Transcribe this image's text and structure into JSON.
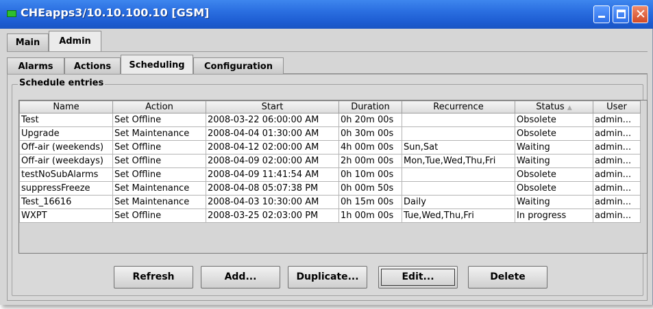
{
  "window": {
    "title": "CHEapps3/10.10.100.10 [GSM]"
  },
  "main_tabs": [
    {
      "label": "Main",
      "active": false
    },
    {
      "label": "Admin",
      "active": true
    }
  ],
  "sub_tabs": [
    {
      "label": "Alarms",
      "active": false
    },
    {
      "label": "Actions",
      "active": false
    },
    {
      "label": "Scheduling",
      "active": true
    },
    {
      "label": "Configuration",
      "active": false
    }
  ],
  "group_title": "Schedule entries",
  "table": {
    "columns": [
      "Name",
      "Action",
      "Start",
      "Duration",
      "Recurrence",
      "Status",
      "User"
    ],
    "rows": [
      [
        "Test",
        "Set Offline",
        "2008-03-22 06:00:00 AM",
        "0h 20m 00s",
        "",
        "Obsolete",
        "admin..."
      ],
      [
        "Upgrade",
        "Set Maintenance",
        "2008-04-04 01:30:00 AM",
        "0h 30m 00s",
        "",
        "Obsolete",
        "admin..."
      ],
      [
        "Off-air (weekends)",
        "Set Offline",
        "2008-04-12 02:00:00 AM",
        "4h 00m 00s",
        "Sun,Sat",
        "Waiting",
        "admin..."
      ],
      [
        "Off-air (weekdays)",
        "Set Offline",
        "2008-04-09 02:00:00 AM",
        "2h 00m 00s",
        "Mon,Tue,Wed,Thu,Fri",
        "Waiting",
        "admin..."
      ],
      [
        "testNoSubAlarms",
        "Set Offline",
        "2008-04-09 11:41:54 AM",
        "0h 10m 00s",
        "",
        "Obsolete",
        "admin..."
      ],
      [
        "suppressFreeze",
        "Set Maintenance",
        "2008-04-08 05:07:38 PM",
        "0h 00m 50s",
        "",
        "Obsolete",
        "admin..."
      ],
      [
        "Test_16616",
        "Set Maintenance",
        "2008-04-03 10:30:00 AM",
        "0h 15m 00s",
        "Daily",
        "Waiting",
        "admin..."
      ],
      [
        "WXPT",
        "Set Offline",
        "2008-03-25 02:03:00 PM",
        "1h 00m 00s",
        "Tue,Wed,Thu,Fri",
        "In progress",
        "admin..."
      ]
    ]
  },
  "buttons": {
    "refresh": "Refresh",
    "add": "Add...",
    "duplicate": "Duplicate...",
    "edit": "Edit...",
    "delete": "Delete"
  },
  "colors": {
    "titlebar": "#1c5bd0",
    "app_icon": "#2ec02e",
    "close_button": "#d24a26"
  }
}
